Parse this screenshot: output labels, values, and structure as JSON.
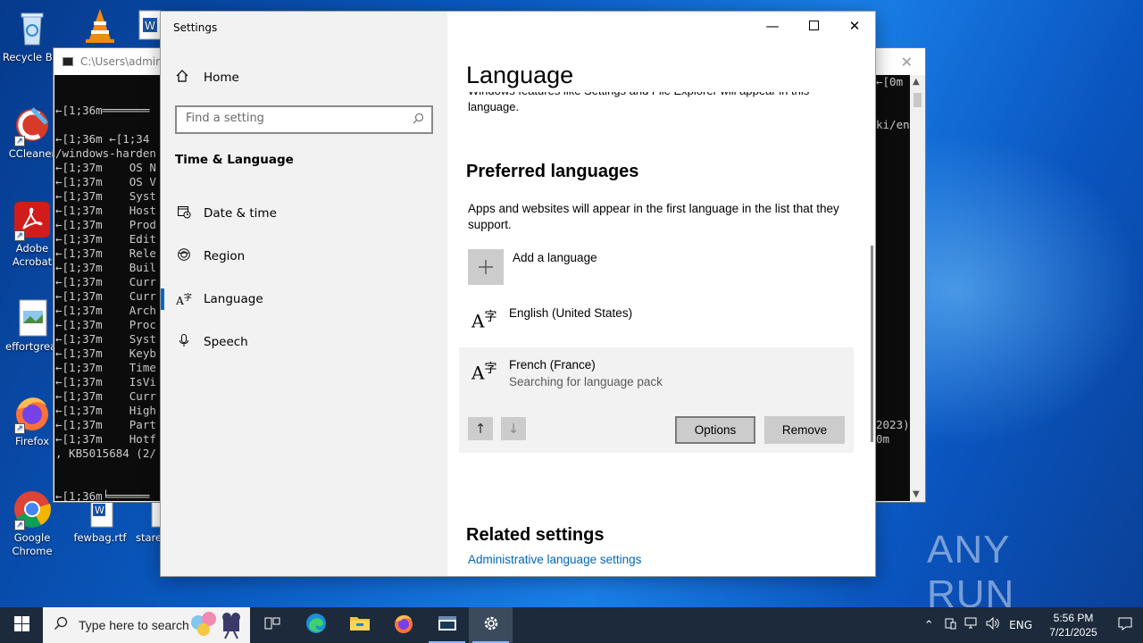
{
  "desktop": {
    "icons": [
      {
        "label": "Recycle Bin"
      },
      {
        "label": "CCleaner"
      },
      {
        "label": "Adobe Acrobat"
      },
      {
        "label": "effortgreat"
      },
      {
        "label": "Firefox"
      },
      {
        "label": "Google Chrome"
      },
      {
        "label": "fewbag.rtf"
      },
      {
        "label": "stare"
      }
    ]
  },
  "console": {
    "title": "C:\\Users\\admin\\",
    "lines": [
      "←[1;36m═══════",
      "",
      "←[1;36m ←[1;34",
      "/windows-harden",
      "←[1;37m    OS N",
      "←[1;37m    OS V",
      "←[1;37m    Syst",
      "←[1;37m    Host",
      "←[1;37m    Prod",
      "←[1;37m    Edit",
      "←[1;37m    Rele",
      "←[1;37m    Buil",
      "←[1;37m    Curr",
      "←[1;37m    Curr",
      "←[1;37m    Arch",
      "←[1;37m    Proc",
      "←[1;37m    Syst",
      "←[1;37m    Keyb",
      "←[1;37m    Time",
      "←[1;37m    IsVi",
      "←[1;37m    Curr",
      "←[1;37m    High",
      "←[1;37m    Part",
      "←[1;37m    Hotf",
      ", KB5015684 (2/",
      "",
      "",
      "←[1;36m╘══════"
    ],
    "right_lines": [
      "←[0m",
      "",
      "",
      "ki/en",
      "",
      "",
      "",
      "",
      "",
      "",
      "",
      "",
      "",
      "",
      "",
      "",
      "",
      "",
      "",
      "",
      "",
      "",
      "",
      "",
      "2023)",
      "0m"
    ]
  },
  "settings": {
    "window_title": "Settings",
    "home_label": "Home",
    "search_placeholder": "Find a setting",
    "section_title": "Time & Language",
    "nav": [
      {
        "label": "Date & time",
        "icon": "calendar-clock-icon"
      },
      {
        "label": "Region",
        "icon": "globe-icon"
      },
      {
        "label": "Language",
        "icon": "language-icon"
      },
      {
        "label": "Speech",
        "icon": "microphone-icon"
      }
    ],
    "page_title": "Language",
    "partial_text_line1": "Windows features like Settings and File Explorer will appear in this",
    "partial_text_line2": "language.",
    "preferred_title": "Preferred languages",
    "preferred_desc": "Apps and websites will appear in the first language in the list that they support.",
    "add_language": "Add a language",
    "languages": [
      {
        "name": "English (United States)",
        "status": ""
      },
      {
        "name": "French (France)",
        "status": "Searching for language pack"
      }
    ],
    "options_label": "Options",
    "remove_label": "Remove",
    "related_title": "Related settings",
    "admin_link": "Administrative language settings"
  },
  "watermark": "ANY RUN",
  "taskbar": {
    "search_placeholder": "Type here to search",
    "language": "ENG",
    "time": "5:56 PM",
    "date": "7/21/2025"
  },
  "colors": {
    "accent": "#0067c0",
    "link": "#0067b8",
    "taskbar": "#1c2a3c"
  }
}
